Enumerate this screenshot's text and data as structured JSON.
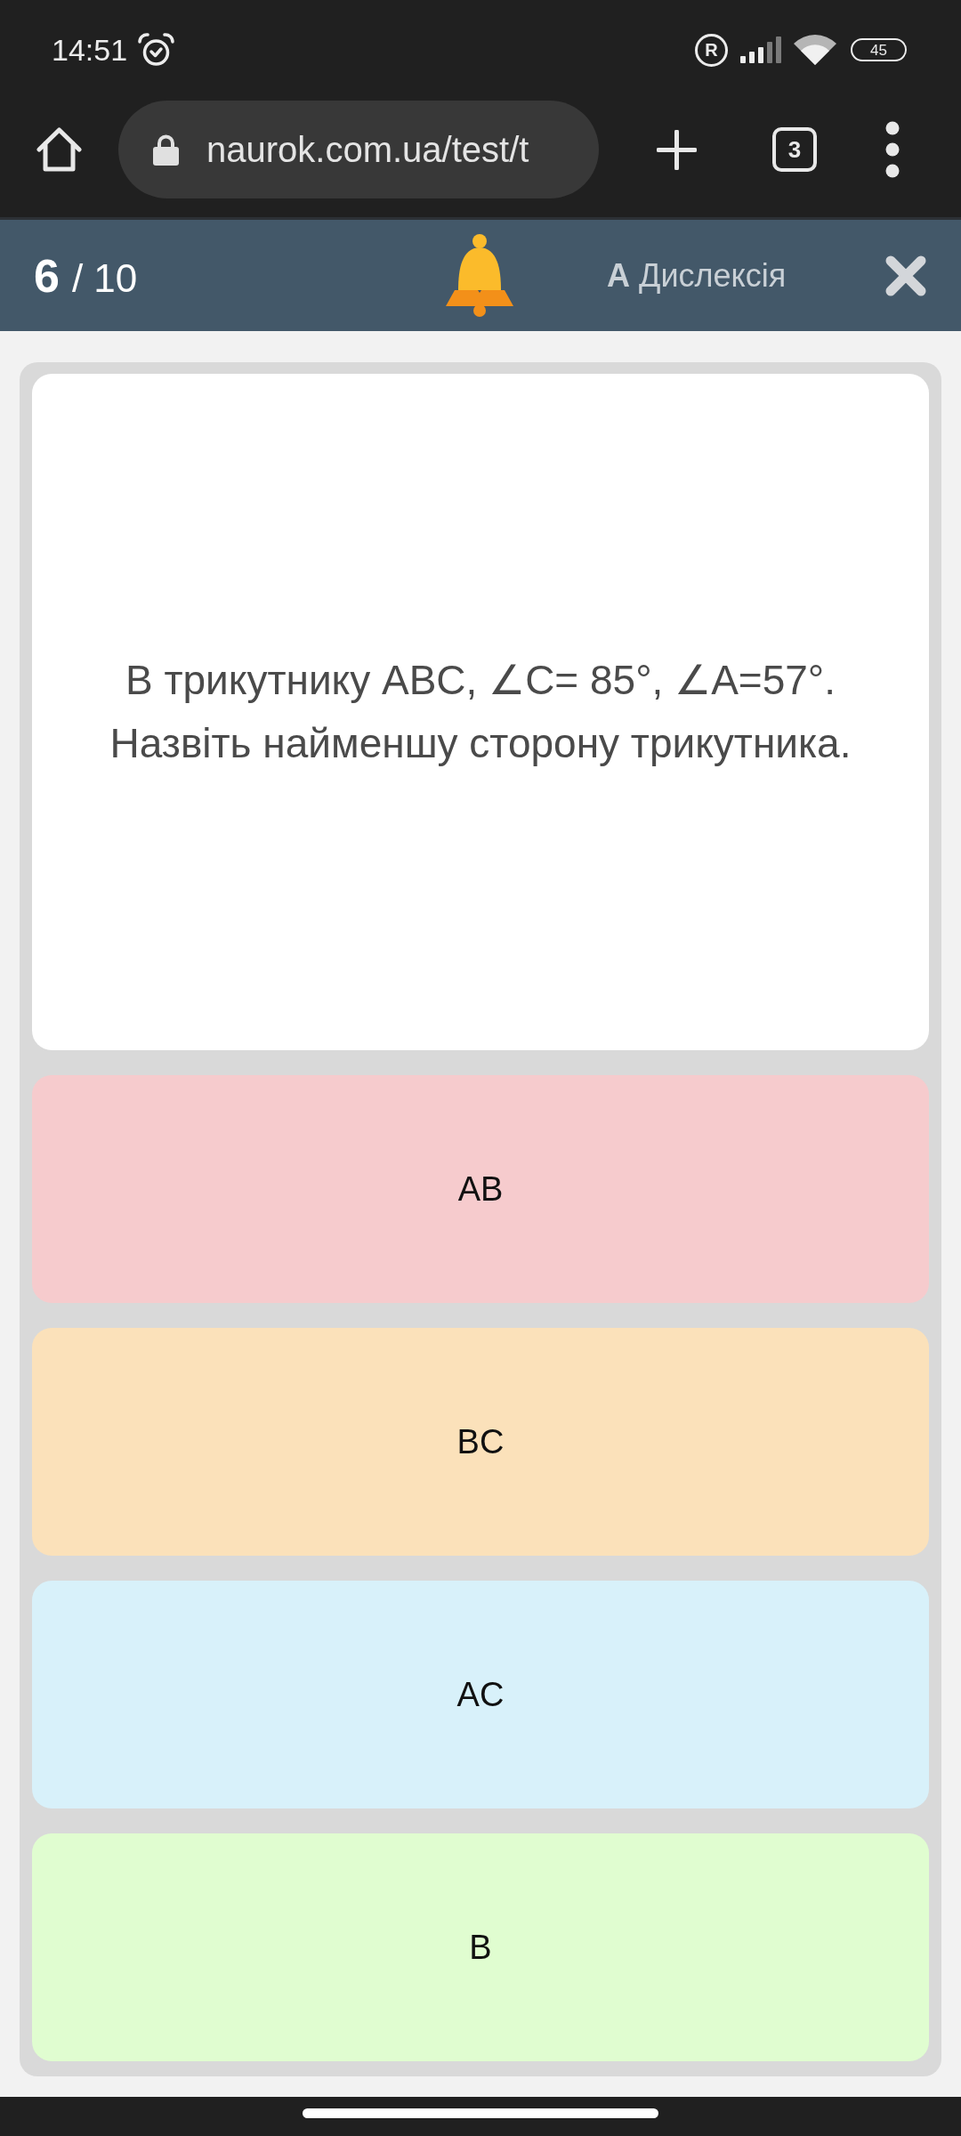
{
  "status_bar": {
    "time": "14:51",
    "roaming": "R",
    "battery": "45"
  },
  "browser": {
    "url": "naurok.com.ua/test/t",
    "tab_count": "3"
  },
  "header": {
    "current": "6",
    "total": "/ 10",
    "dyslexia_label": "**A** Дислексія"
  },
  "question": {
    "text": "В трикутнику ABC, ∠C= 85°, ∠A=57°. Назвіть найменшу сторону трикутника."
  },
  "answers": [
    {
      "label": "AB",
      "color": "#f6cbcd"
    },
    {
      "label": "BC",
      "color": "#fbe1ba"
    },
    {
      "label": "AC",
      "color": "#d8f1fa"
    },
    {
      "label": "B",
      "color": "#e0fdd0"
    }
  ]
}
